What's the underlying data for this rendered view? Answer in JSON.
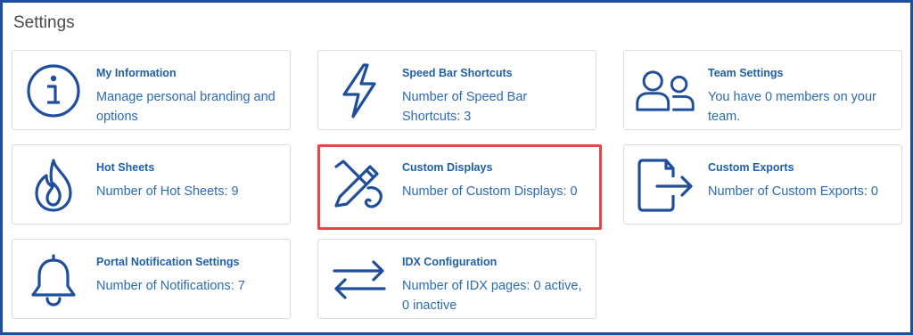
{
  "page": {
    "title": "Settings"
  },
  "colors": {
    "accent": "#1f4e9c",
    "link": "#1f5fa8",
    "highlight": "#e0484a"
  },
  "cards": [
    {
      "icon": "info-icon",
      "title": "My Information",
      "desc": "Manage personal branding and options"
    },
    {
      "icon": "lightning-icon",
      "title": "Speed Bar Shortcuts",
      "desc": "Number of Speed Bar Shortcuts: 3"
    },
    {
      "icon": "team-icon",
      "title": "Team Settings",
      "desc": "You have 0 members on your team."
    },
    {
      "icon": "flame-icon",
      "title": "Hot Sheets",
      "desc": "Number of Hot Sheets: 9"
    },
    {
      "icon": "pencil-brush-icon",
      "title": "Custom Displays",
      "desc": "Number of Custom Displays: 0"
    },
    {
      "icon": "file-export-icon",
      "title": "Custom Exports",
      "desc": "Number of Custom Exports: 0"
    },
    {
      "icon": "bell-icon",
      "title": "Portal Notification Settings",
      "desc": "Number of Notifications: 7"
    },
    {
      "icon": "swap-arrows-icon",
      "title": "IDX Configuration",
      "desc": "Number of IDX pages: 0 active, 0 inactive"
    }
  ]
}
